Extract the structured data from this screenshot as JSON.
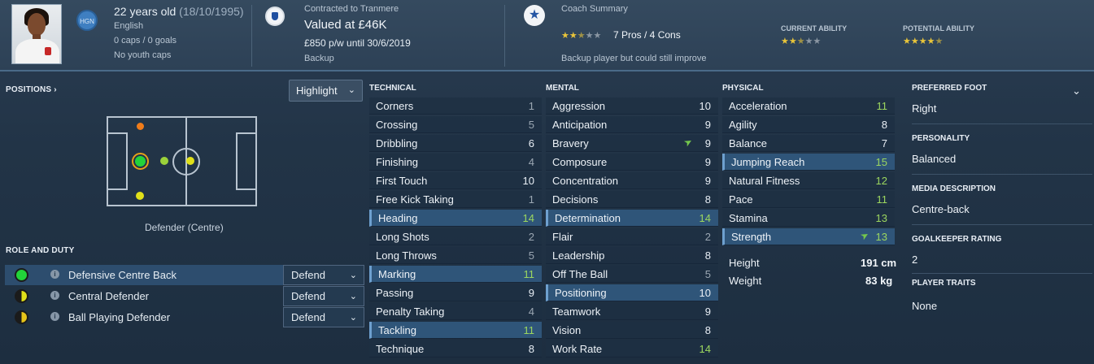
{
  "header": {
    "age": "22 years old",
    "dob": "(18/10/1995)",
    "nationality_code": "HGN",
    "nationality": "English",
    "caps": "0 caps / 0 goals",
    "youth_caps": "No youth caps",
    "contract_label": "Contracted to Tranmere",
    "valuation": "Valued at £46K",
    "wage": "£850 p/w until 30/6/2019",
    "squad_status": "Backup",
    "coach_label": "Coach Summary",
    "coach_stars": 2.5,
    "pros_cons": "7 Pros / 4 Cons",
    "coach_comment": "Backup player but could still improve",
    "current_ability_label": "CURRENT ABILITY",
    "current_ability_stars": 2.5,
    "potential_ability_label": "POTENTIAL ABILITY",
    "potential_ability_stars": 4.5
  },
  "positions": {
    "title": "POSITIONS",
    "highlight_label": "Highlight",
    "position_name": "Defender (Centre)"
  },
  "roles": {
    "title": "ROLE AND DUTY",
    "items": [
      {
        "name": "Defensive Centre Back",
        "duty": "Defend",
        "rating": "natural"
      },
      {
        "name": "Central Defender",
        "duty": "Defend",
        "rating": "accomplished"
      },
      {
        "name": "Ball Playing Defender",
        "duty": "Defend",
        "rating": "competent"
      }
    ]
  },
  "technical": {
    "title": "TECHNICAL",
    "attrs": [
      {
        "name": "Corners",
        "value": "1"
      },
      {
        "name": "Crossing",
        "value": "5"
      },
      {
        "name": "Dribbling",
        "value": "6"
      },
      {
        "name": "Finishing",
        "value": "4"
      },
      {
        "name": "First Touch",
        "value": "10"
      },
      {
        "name": "Free Kick Taking",
        "value": "1"
      },
      {
        "name": "Heading",
        "value": "14"
      },
      {
        "name": "Long Shots",
        "value": "2"
      },
      {
        "name": "Long Throws",
        "value": "5"
      },
      {
        "name": "Marking",
        "value": "11"
      },
      {
        "name": "Passing",
        "value": "9"
      },
      {
        "name": "Penalty Taking",
        "value": "4"
      },
      {
        "name": "Tackling",
        "value": "11"
      },
      {
        "name": "Technique",
        "value": "8"
      }
    ]
  },
  "mental": {
    "title": "MENTAL",
    "attrs": [
      {
        "name": "Aggression",
        "value": "10"
      },
      {
        "name": "Anticipation",
        "value": "9"
      },
      {
        "name": "Bravery",
        "value": "9"
      },
      {
        "name": "Composure",
        "value": "9"
      },
      {
        "name": "Concentration",
        "value": "9"
      },
      {
        "name": "Decisions",
        "value": "8"
      },
      {
        "name": "Determination",
        "value": "14"
      },
      {
        "name": "Flair",
        "value": "2"
      },
      {
        "name": "Leadership",
        "value": "8"
      },
      {
        "name": "Off The Ball",
        "value": "5"
      },
      {
        "name": "Positioning",
        "value": "10"
      },
      {
        "name": "Teamwork",
        "value": "9"
      },
      {
        "name": "Vision",
        "value": "8"
      },
      {
        "name": "Work Rate",
        "value": "14"
      }
    ]
  },
  "physical": {
    "title": "PHYSICAL",
    "attrs": [
      {
        "name": "Acceleration",
        "value": "11"
      },
      {
        "name": "Agility",
        "value": "8"
      },
      {
        "name": "Balance",
        "value": "7"
      },
      {
        "name": "Jumping Reach",
        "value": "15"
      },
      {
        "name": "Natural Fitness",
        "value": "12"
      },
      {
        "name": "Pace",
        "value": "11"
      },
      {
        "name": "Stamina",
        "value": "13"
      },
      {
        "name": "Strength",
        "value": "13"
      }
    ],
    "height_label": "Height",
    "height": "191 cm",
    "weight_label": "Weight",
    "weight": "83 kg"
  },
  "profile": {
    "foot_label": "PREFERRED FOOT",
    "foot": "Right",
    "personality_label": "PERSONALITY",
    "personality": "Balanced",
    "media_label": "MEDIA DESCRIPTION",
    "media": "Centre-back",
    "gk_label": "GOALKEEPER RATING",
    "gk": "2",
    "traits_label": "PLAYER TRAITS",
    "traits": "None"
  },
  "colors": {
    "natural": "#22d33a",
    "accomplished": "#e0e019",
    "competent": "#e6c419",
    "unconvincing": "#f07c1a",
    "value_high": "#9cd75f"
  }
}
